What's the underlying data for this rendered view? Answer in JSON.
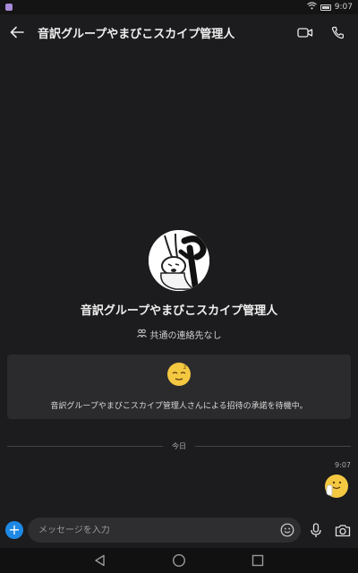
{
  "status_bar": {
    "time": "9:07",
    "icons": [
      "app-notification-icon",
      "wifi-icon",
      "battery-icon"
    ]
  },
  "header": {
    "back_icon": "arrow-left-icon",
    "title": "音訳グループやまびこスカイプ管理人",
    "actions": [
      "video-call-icon",
      "phone-call-icon"
    ]
  },
  "profile": {
    "name": "音訳グループやまびこスカイプ管理人",
    "mutual_contacts": "共通の連絡先なし"
  },
  "invite": {
    "emoji": "sleeping-face-emoji",
    "text": "音訳グループやまびこスカイプ管理人さんによる招待の承諾を待機中。"
  },
  "conversation": {
    "date_label": "今日",
    "messages": [
      {
        "time": "9:07",
        "content": "waving-hand-emoji"
      }
    ]
  },
  "composer": {
    "placeholder": "メッセージを入力",
    "actions": [
      "emoji-icon",
      "microphone-icon",
      "camera-icon"
    ]
  },
  "nav_bar": {
    "buttons": [
      "back-triangle-icon",
      "home-circle-icon",
      "recents-square-icon"
    ]
  },
  "colors": {
    "background": "#1c1c1e",
    "accent": "#1e88e5",
    "card": "#2b2b2d"
  }
}
